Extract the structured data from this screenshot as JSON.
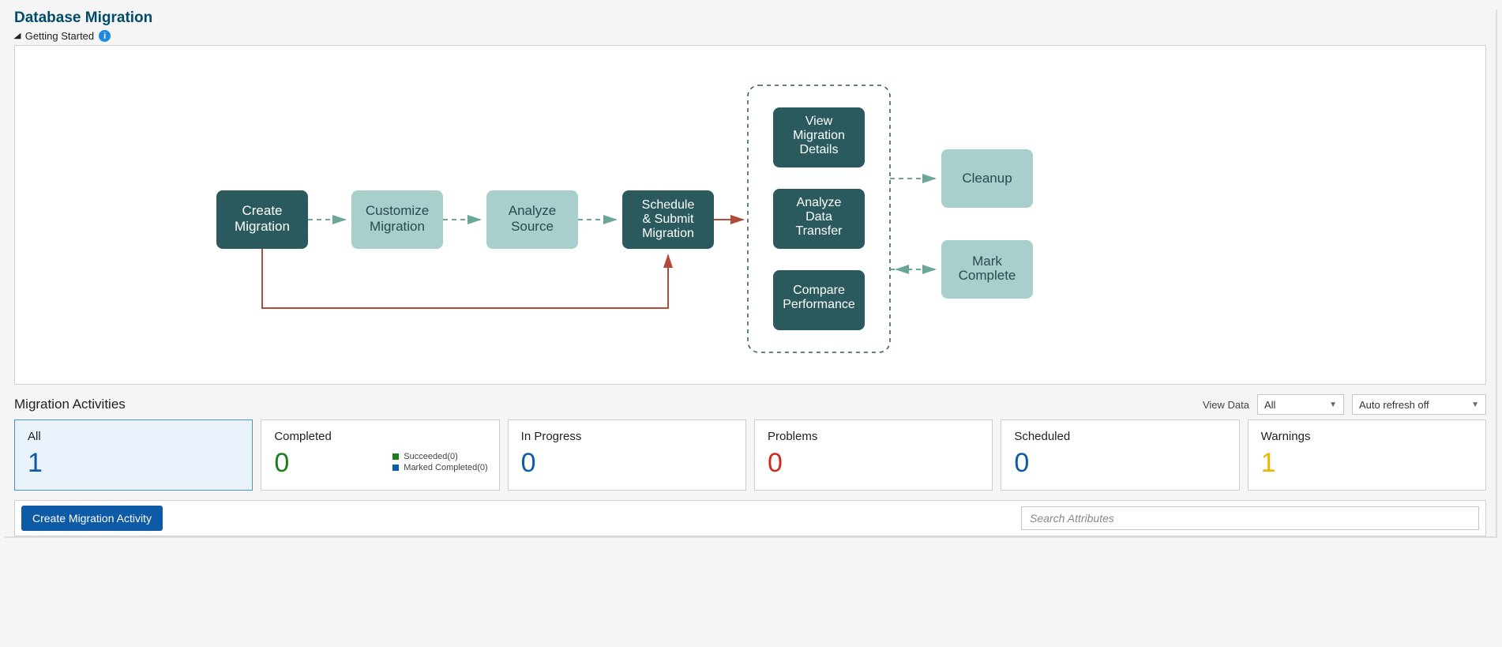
{
  "page_title": "Database Migration",
  "getting_started": "Getting Started",
  "workflow": {
    "create": "Create\nMigration",
    "customize": "Customize\nMigration",
    "analyze_source": "Analyze\nSource",
    "schedule": "Schedule\n& Submit\nMigration",
    "view_details": "View\nMigration\nDetails",
    "analyze_transfer": "Analyze\nData\nTransfer",
    "compare_perf": "Compare\nPerformance",
    "cleanup": "Cleanup",
    "mark_complete": "Mark\nComplete"
  },
  "activities": {
    "header": "Migration Activities",
    "view_data_label": "View Data",
    "view_data_value": "All",
    "refresh_value": "Auto refresh off",
    "cards": {
      "all": {
        "title": "All",
        "value": "1"
      },
      "completed": {
        "title": "Completed",
        "value": "0",
        "succeeded": "Succeeded(0)",
        "marked": "Marked Completed(0)"
      },
      "inprogress": {
        "title": "In Progress",
        "value": "0"
      },
      "problems": {
        "title": "Problems",
        "value": "0"
      },
      "scheduled": {
        "title": "Scheduled",
        "value": "0"
      },
      "warnings": {
        "title": "Warnings",
        "value": "1"
      }
    },
    "create_button": "Create Migration Activity",
    "search_placeholder": "Search Attributes"
  },
  "colors": {
    "dark": "#2a5a5e",
    "light": "#a8cfcb",
    "red": "#b34b3a",
    "green_arrow": "#6aa69a"
  }
}
